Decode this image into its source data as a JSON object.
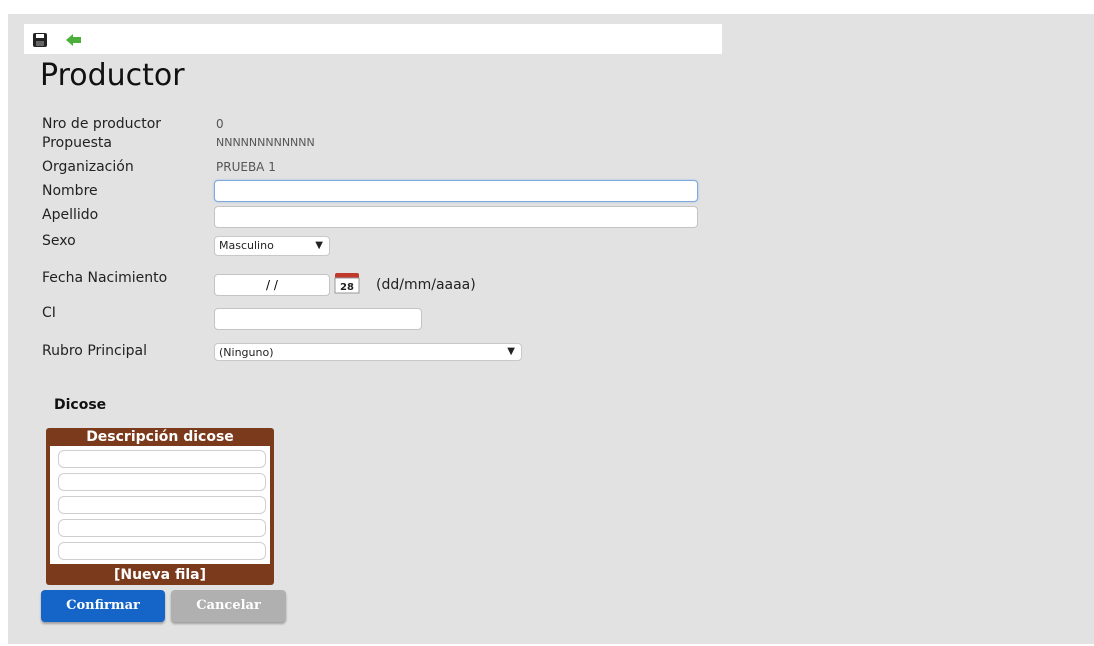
{
  "page": {
    "title": "Productor"
  },
  "toolbar": {
    "save_icon": "floppy-disk-icon",
    "back_icon": "back-arrow-icon"
  },
  "fields": {
    "nro_label": "Nro de productor",
    "nro_value": "0",
    "propuesta_label": "Propuesta",
    "propuesta_value": "NNNNNNNNNNNN",
    "organizacion_label": "Organización",
    "organizacion_value": "PRUEBA 1",
    "nombre_label": "Nombre",
    "nombre_value": "",
    "apellido_label": "Apellido",
    "apellido_value": "",
    "sexo_label": "Sexo",
    "sexo_value": "Masculino",
    "fecha_label": "Fecha Nacimiento",
    "fecha_value": "/ /",
    "calendar_icon": "calendar-icon",
    "calendar_day": "28",
    "fecha_hint": "(dd/mm/aaaa)",
    "ci_label": "CI",
    "ci_value": "",
    "rubro_label": "Rubro Principal",
    "rubro_value": "(Ninguno)"
  },
  "dicose": {
    "section_title": "Dicose",
    "column_header": "Descripción dicose",
    "rows": [
      "",
      "",
      "",
      "",
      ""
    ],
    "new_row": "[Nueva fila]"
  },
  "buttons": {
    "confirm": "Confirmar",
    "cancel": "Cancelar"
  },
  "colors": {
    "grid_brown": "#7b3a1c",
    "confirm_blue": "#1565c8",
    "cancel_gray": "#b0b0b0",
    "back_arrow_green": "#4caf3a"
  }
}
